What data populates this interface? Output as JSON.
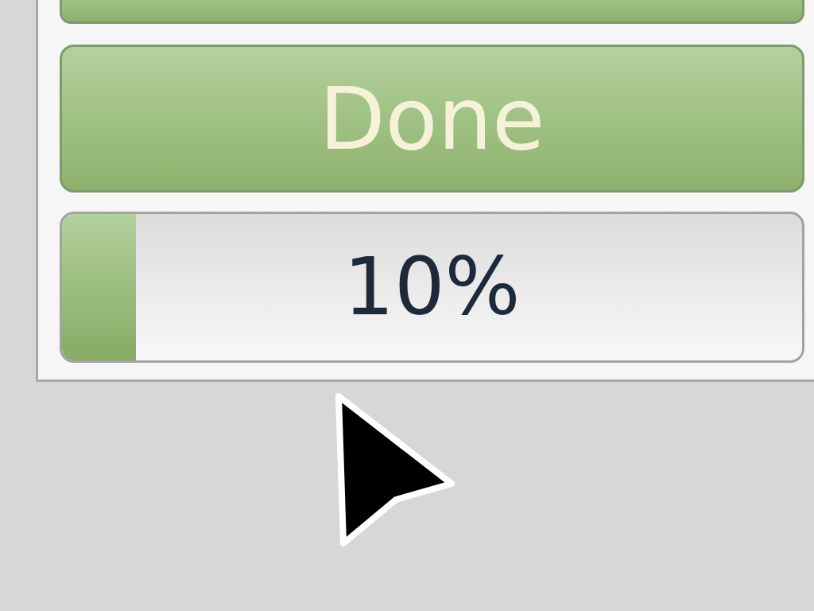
{
  "buttons": [
    {
      "label": "Done"
    }
  ],
  "progress": {
    "level": 0.1,
    "reading": "10%"
  }
}
